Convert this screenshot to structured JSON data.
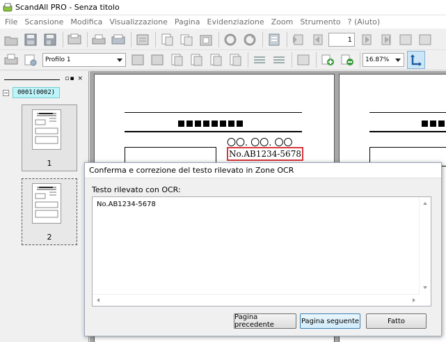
{
  "window": {
    "title": "ScandAll PRO - Senza titolo"
  },
  "menu": {
    "items": [
      "File",
      "Scansione",
      "Modifica",
      "Visualizzazione",
      "Pagina",
      "Evidenziazione",
      "Zoom",
      "Strumento",
      "? (Aiuto)"
    ]
  },
  "toolbar1": {
    "page_field_value": "1"
  },
  "toolbar2": {
    "profile_value": "Profilo 1",
    "zoom_value": "16.87%"
  },
  "tree": {
    "batch_label": "0001(0002)",
    "collapse_symbol": "−",
    "panel_controls": "▫▪ ×"
  },
  "thumbnails": [
    {
      "number": "1"
    },
    {
      "number": "2"
    }
  ],
  "document": {
    "date_text": "〇〇. 〇〇. 〇〇",
    "ocr_zone_text": "No.AB1234-5678"
  },
  "dialog": {
    "title": "Conferma e correzione del testo rilevato in Zone OCR",
    "label": "Testo rilevato con OCR:",
    "text_value": "No.AB1234-5678",
    "buttons": {
      "previous": "Pagina precedente",
      "next": "Pagina seguente",
      "done": "Fatto"
    }
  }
}
